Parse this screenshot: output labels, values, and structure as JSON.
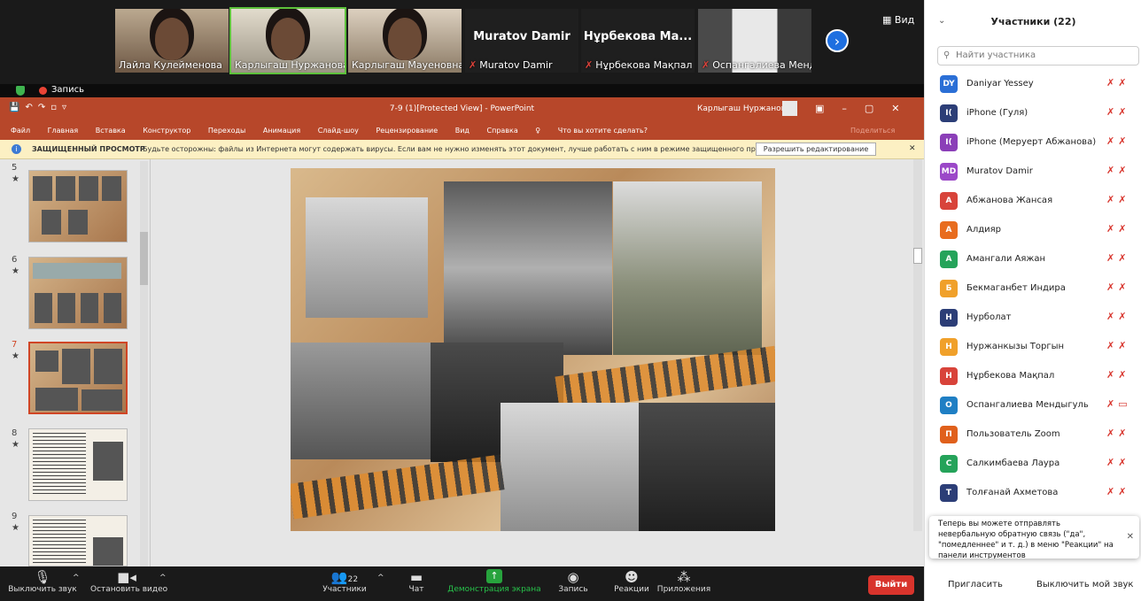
{
  "gallery": {
    "tiles": [
      {
        "name": "Лайла Кулейменова"
      },
      {
        "name": "Карлыгаш Нуржанова"
      },
      {
        "name": "Карлыгаш Мауеновна"
      },
      {
        "big": "Muratov Damir",
        "name": "Muratov Damir"
      },
      {
        "big": "Нұрбекова Ма...",
        "name": "Нұрбекова Мақпал"
      },
      {
        "name": "Оспангалиева Менд..."
      }
    ],
    "view_label": "Вид"
  },
  "recording": {
    "label": "Запись"
  },
  "ppt": {
    "file_title": "7-9 (1)[Protected View] - PowerPoint",
    "user": "Карлыгаш Нуржанова",
    "menu": [
      "Файл",
      "Главная",
      "Вставка",
      "Конструктор",
      "Переходы",
      "Анимация",
      "Слайд-шоу",
      "Рецензирование",
      "Вид",
      "Справка",
      "Что вы хотите сделать?"
    ],
    "share": "Поделиться",
    "protected": {
      "title": "ЗАЩИЩЕННЫЙ ПРОСМОТР",
      "message": "Будьте осторожны: файлы из Интернета могут содержать вирусы. Если вам не нужно изменять этот документ, лучше работать с ним в режиме защищенного просмотра.",
      "enable_button": "Разрешить редактирование"
    },
    "thumbnails": [
      {
        "num": "5"
      },
      {
        "num": "6"
      },
      {
        "num": "7"
      },
      {
        "num": "8"
      },
      {
        "num": "9"
      }
    ]
  },
  "toolbar": {
    "mute": "Выключить звук",
    "video": "Остановить видео",
    "participants": "Участники",
    "participants_count": "22",
    "chat": "Чат",
    "share": "Демонстрация экрана",
    "record": "Запись",
    "reactions": "Реакции",
    "apps": "Приложения",
    "leave": "Выйти"
  },
  "panel": {
    "title": "Участники (22)",
    "search_placeholder": "Найти участника",
    "participants": [
      {
        "initials": "DY",
        "name": "Daniyar Yessey",
        "color": "#2b6fd6"
      },
      {
        "initials": "I(",
        "name": "iPhone (Гуля)",
        "color": "#2c3e77"
      },
      {
        "initials": "I(",
        "name": "iPhone (Меруерт Абжанова)",
        "color": "#8b3fb8"
      },
      {
        "initials": "MD",
        "name": "Muratov Damir",
        "color": "#9b48c8"
      },
      {
        "initials": "A",
        "name": "Абжанова Жансая",
        "color": "#d8433a"
      },
      {
        "initials": "A",
        "name": "Алдияр",
        "color": "#e86c1e"
      },
      {
        "initials": "A",
        "name": "Амангали Аяжан",
        "color": "#25a35a"
      },
      {
        "initials": "Б",
        "name": "Бекмаганбет Индира",
        "color": "#f0a02a"
      },
      {
        "initials": "Н",
        "name": "Нурболат",
        "color": "#2c3e77"
      },
      {
        "initials": "Н",
        "name": "Нуржанкызы Торгын",
        "color": "#f0a02a"
      },
      {
        "initials": "Н",
        "name": "Нұрбекова Мақпал",
        "color": "#d8433a"
      },
      {
        "initials": "О",
        "name": "Оспангалиева Мендыгуль",
        "color": "#1f7fc4"
      },
      {
        "initials": "П",
        "name": "Пользователь Zoom",
        "color": "#e0601c"
      },
      {
        "initials": "С",
        "name": "Салкимбаева Лаура",
        "color": "#25a35a"
      },
      {
        "initials": "Т",
        "name": "Толғанай Ахметова",
        "color": "#2c3e77"
      }
    ],
    "toast": "Теперь вы можете отправлять невербальную обратную связь (\"да\", \"помедленнее\" и т. д.) в меню \"Реакции\" на панели инструментов",
    "invite": "Пригласить",
    "mute_me": "Выключить мой звук"
  }
}
